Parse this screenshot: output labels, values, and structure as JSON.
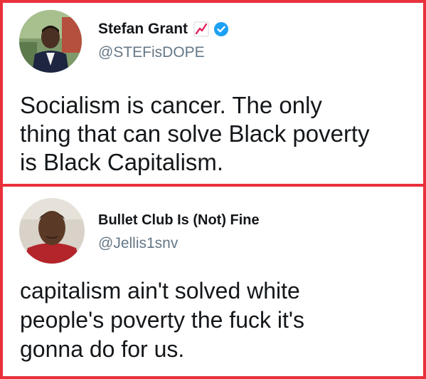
{
  "tweets": [
    {
      "display_name": "Stefan Grant",
      "handle": "@STEFisDOPE",
      "name_emoji": "chart-increasing-icon",
      "verified": true,
      "text": "Socialism is cancer. The only\nthing that can solve Black poverty\nis Black Capitalism."
    },
    {
      "display_name": "Bullet Club Is (Not) Fine",
      "handle": "@Jellis1snv",
      "verified": false,
      "text": "capitalism ain't solved white\npeople's poverty the fuck it's\ngonna do for us."
    }
  ],
  "colors": {
    "frame_border": "#e8313a",
    "verified_blue": "#1da1f2",
    "handle_gray": "#657786",
    "text": "#14171a"
  }
}
